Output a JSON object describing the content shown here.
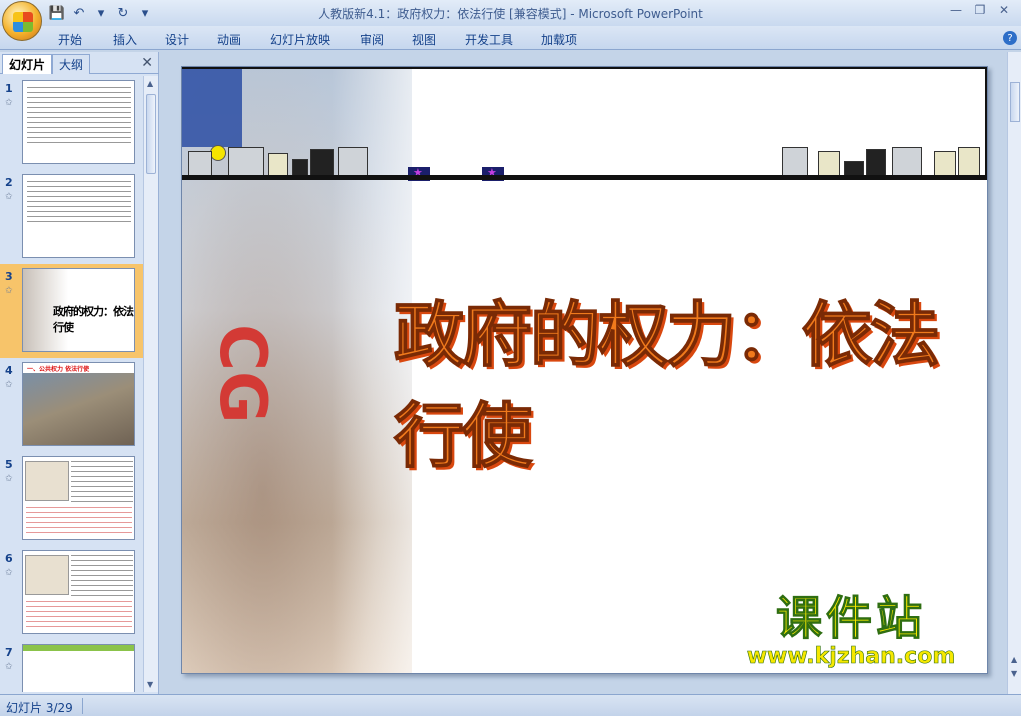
{
  "window": {
    "title": "人教版新4.1：政府权力：依法行使 [兼容模式] - Microsoft PowerPoint"
  },
  "ribbon": {
    "tabs": [
      "开始",
      "插入",
      "设计",
      "动画",
      "幻灯片放映",
      "审阅",
      "视图",
      "开发工具",
      "加载项"
    ]
  },
  "left_pane": {
    "tab_slides": "幻灯片",
    "tab_outline": "大纲",
    "thumbnails": [
      {
        "num": "1",
        "selected": false
      },
      {
        "num": "2",
        "selected": false
      },
      {
        "num": "3",
        "selected": true,
        "title": "政府的权力：依法行使"
      },
      {
        "num": "4",
        "selected": false,
        "title": "一、公共权力 依法行使"
      },
      {
        "num": "5",
        "selected": false
      },
      {
        "num": "6",
        "selected": false
      },
      {
        "num": "7",
        "selected": false
      }
    ]
  },
  "slide": {
    "title": "政府的权力：依法行使",
    "side_letters": "CG",
    "watermark_cn": "课件站",
    "watermark_url": "www.kjzhan.com"
  },
  "status": {
    "slide_indicator": "幻灯片 3/29"
  },
  "colors": {
    "title_fill": "#f07a1c",
    "watermark_fill": "#f6e800",
    "selected_thumb": "#f7c46a"
  }
}
